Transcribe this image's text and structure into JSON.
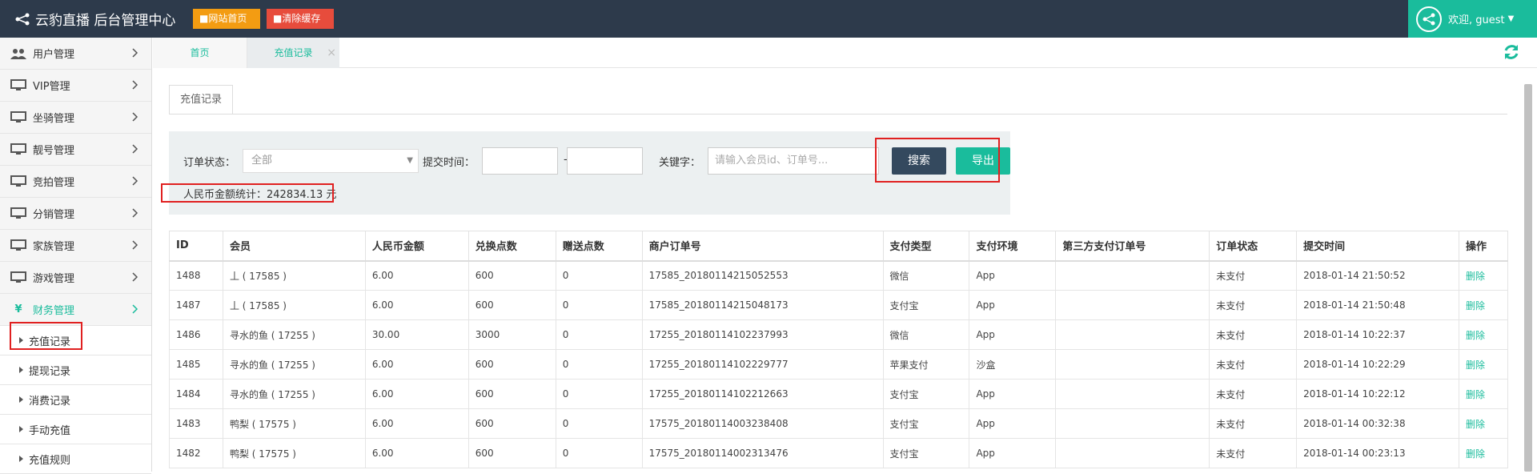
{
  "topbar": {
    "title": "云豹直播 后台管理中心",
    "home_btn": "网站首页",
    "cache_btn": "清除缓存",
    "welcome": "欢迎, guest"
  },
  "sidebar": {
    "items": [
      {
        "label": "用户管理",
        "icon": "users-icon"
      },
      {
        "label": "VIP管理",
        "icon": "monitor-icon"
      },
      {
        "label": "坐骑管理",
        "icon": "monitor-icon"
      },
      {
        "label": "靓号管理",
        "icon": "monitor-icon"
      },
      {
        "label": "竞拍管理",
        "icon": "monitor-icon"
      },
      {
        "label": "分销管理",
        "icon": "monitor-icon"
      },
      {
        "label": "家族管理",
        "icon": "monitor-icon"
      },
      {
        "label": "游戏管理",
        "icon": "monitor-icon"
      },
      {
        "label": "财务管理",
        "icon": "yen-icon"
      }
    ],
    "yen_glyph": "¥",
    "sub_items": [
      "充值记录",
      "提现记录",
      "消费记录",
      "手动充值",
      "充值规则"
    ]
  },
  "tabs": {
    "home": "首页",
    "current": "充值记录",
    "close": "×"
  },
  "page": {
    "inner_tab": "充值记录"
  },
  "filter": {
    "status_label": "订单状态：",
    "status_value": "全部",
    "time_label": "提交时间：",
    "time_sep": "-",
    "keyword_label": "关键字：",
    "keyword_placeholder": "请输入会员id、订单号...",
    "search_btn": "搜索",
    "export_btn": "导出",
    "summary": "人民币金额统计：242834.13 元"
  },
  "table": {
    "headers": [
      "ID",
      "会员",
      "人民币金额",
      "兑换点数",
      "赠送点数",
      "商户订单号",
      "支付类型",
      "支付环境",
      "第三方支付订单号",
      "订单状态",
      "提交时间",
      "操作"
    ],
    "rows": [
      [
        "1488",
        "丄 ( 17585 )",
        "6.00",
        "600",
        "0",
        "17585_20180114215052553",
        "微信",
        "App",
        "",
        "未支付",
        "2018-01-14 21:50:52",
        "删除"
      ],
      [
        "1487",
        "丄 ( 17585 )",
        "6.00",
        "600",
        "0",
        "17585_20180114215048173",
        "支付宝",
        "App",
        "",
        "未支付",
        "2018-01-14 21:50:48",
        "删除"
      ],
      [
        "1486",
        "寻水的鱼 ( 17255 )",
        "30.00",
        "3000",
        "0",
        "17255_20180114102237993",
        "微信",
        "App",
        "",
        "未支付",
        "2018-01-14 10:22:37",
        "删除"
      ],
      [
        "1485",
        "寻水的鱼 ( 17255 )",
        "6.00",
        "600",
        "0",
        "17255_20180114102229777",
        "苹果支付",
        "沙盒",
        "",
        "未支付",
        "2018-01-14 10:22:29",
        "删除"
      ],
      [
        "1484",
        "寻水的鱼 ( 17255 )",
        "6.00",
        "600",
        "0",
        "17255_20180114102212663",
        "支付宝",
        "App",
        "",
        "未支付",
        "2018-01-14 10:22:12",
        "删除"
      ],
      [
        "1483",
        "鸭梨 ( 17575 )",
        "6.00",
        "600",
        "0",
        "17575_20180114003238408",
        "支付宝",
        "App",
        "",
        "未支付",
        "2018-01-14 00:32:38",
        "删除"
      ],
      [
        "1482",
        "鸭梨 ( 17575 )",
        "6.00",
        "600",
        "0",
        "17575_20180114002313476",
        "支付宝",
        "App",
        "",
        "未支付",
        "2018-01-14 00:23:13",
        "删除"
      ]
    ]
  },
  "colors": {
    "topbar": "#2d3a4b",
    "accent": "#1abc9c",
    "orange": "#f39c12",
    "red": "#e74c3c",
    "search": "#34495e"
  }
}
